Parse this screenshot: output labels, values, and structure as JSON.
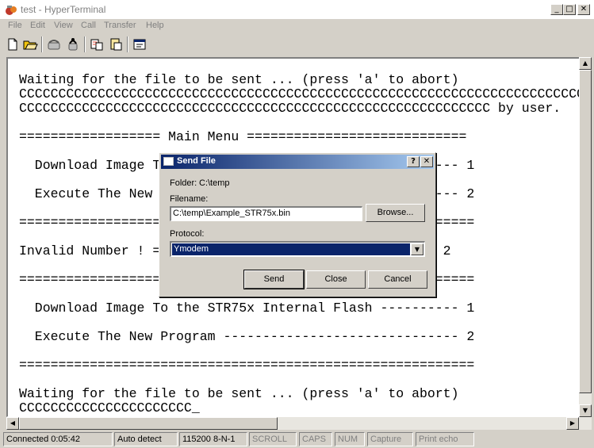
{
  "window": {
    "title": "test - HyperTerminal",
    "minimize": "_",
    "maximize": "□",
    "close": "✕"
  },
  "menu": [
    "File",
    "Edit",
    "View",
    "Call",
    "Transfer",
    "Help"
  ],
  "toolbar": [
    "new-icon",
    "open-icon",
    "phone-icon",
    "disconnect-icon",
    "send-icon",
    "receive-icon",
    "properties-icon"
  ],
  "terminal": {
    "lines": [
      "Waiting for the file to be sent ... (press 'a' to abort)",
      "CCCCCCCCCCCCCCCCCCCCCCCCCCCCCCCCCCCCCCCCCCCCCCCCCCCCCCCCCCCCCCCCCCCCCCCCCC",
      "CCCCCCCCCCCCCCCCCCCCCCCCCCCCCCCCCCCCCCCCCCCCCCCCCCCCCCCCCCCC by user.",
      "",
      "================== Main Menu ============================",
      "",
      "  Download Image To the STR75x Internal Flash ---------- 1",
      "",
      "  Execute The New Program ------------------------------ 2",
      "",
      "==========================================================",
      "",
      "Invalid Number ! ==> The number should be either 1 or 2",
      "",
      "==========================================================",
      "",
      "  Download Image To the STR75x Internal Flash ---------- 1",
      "",
      "  Execute The New Program ------------------------------ 2",
      "",
      "==========================================================",
      "",
      "Waiting for the file to be sent ... (press 'a' to abort)",
      "CCCCCCCCCCCCCCCCCCCCCC_"
    ]
  },
  "dialog": {
    "title": "Send File",
    "help": "?",
    "close": "✕",
    "folder_label": "Folder:",
    "folder_value": "C:\\temp",
    "filename_label": "Filename:",
    "filename_value": "C:\\temp\\Example_STR75x.bin",
    "browse_label": "Browse...",
    "protocol_label": "Protocol:",
    "protocol_value": "Ymodem",
    "send_label": "Send",
    "close_label": "Close",
    "cancel_label": "Cancel"
  },
  "status": {
    "connected": "Connected 0:05:42",
    "detect": "Auto detect",
    "settings": "115200 8-N-1",
    "scroll": "SCROLL",
    "caps": "CAPS",
    "num": "NUM",
    "capture": "Capture",
    "print_echo": "Print echo"
  },
  "arrows": {
    "up": "▲",
    "down": "▼",
    "left": "◀",
    "right": "▶",
    "dropdown": "▼"
  }
}
